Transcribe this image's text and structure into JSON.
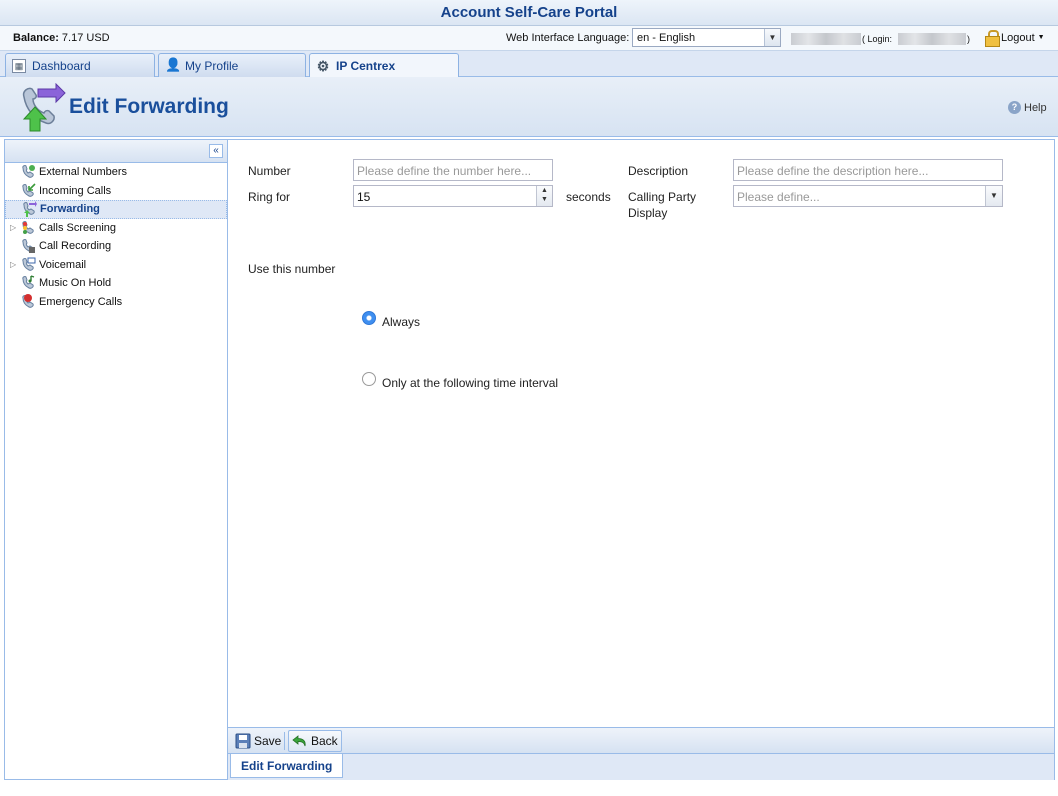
{
  "app": {
    "title": "Account Self-Care Portal"
  },
  "infobar": {
    "balance_label": "Balance:",
    "balance_value": "7.17 USD",
    "language_label": "Web Interface Language:",
    "language_value": "en - English",
    "login_open": "( Login:",
    "login_close": ")",
    "logout_label": "Logout"
  },
  "tabs": [
    {
      "label": "Dashboard",
      "icon": "dashboard-icon"
    },
    {
      "label": "My Profile",
      "icon": "person-icon"
    },
    {
      "label": "IP Centrex",
      "icon": "gear-icon",
      "active": true
    }
  ],
  "header": {
    "title": "Edit Forwarding",
    "help_label": "Help"
  },
  "sidebar": {
    "items": [
      {
        "label": "External Numbers",
        "icon": "external-numbers-icon"
      },
      {
        "label": "Incoming Calls",
        "icon": "incoming-calls-icon"
      },
      {
        "label": "Forwarding",
        "icon": "forwarding-icon",
        "selected": true
      },
      {
        "label": "Calls Screening",
        "icon": "calls-screening-icon",
        "expandable": true
      },
      {
        "label": "Call Recording",
        "icon": "call-recording-icon"
      },
      {
        "label": "Voicemail",
        "icon": "voicemail-icon",
        "expandable": true
      },
      {
        "label": "Music On Hold",
        "icon": "music-icon"
      },
      {
        "label": "Emergency Calls",
        "icon": "emergency-icon"
      }
    ]
  },
  "form": {
    "number_label": "Number",
    "number_placeholder": "Please define the number here...",
    "description_label": "Description",
    "description_placeholder": "Please define the description here...",
    "ring_for_label": "Ring for",
    "ring_for_value": "15",
    "seconds_label": "seconds",
    "calling_party_label_1": "Calling Party",
    "calling_party_label_2": "Display",
    "calling_party_placeholder": "Please define...",
    "use_number_label": "Use this number",
    "always_label": "Always",
    "interval_label": "Only at the following time interval",
    "selected_option": "Always"
  },
  "toolbar": {
    "save_label": "Save",
    "back_label": "Back"
  },
  "bottom_tab": {
    "label": "Edit Forwarding"
  },
  "colors": {
    "accent": "#15428b",
    "border": "#99bbe8",
    "radio_on": "#3f8ff0"
  }
}
